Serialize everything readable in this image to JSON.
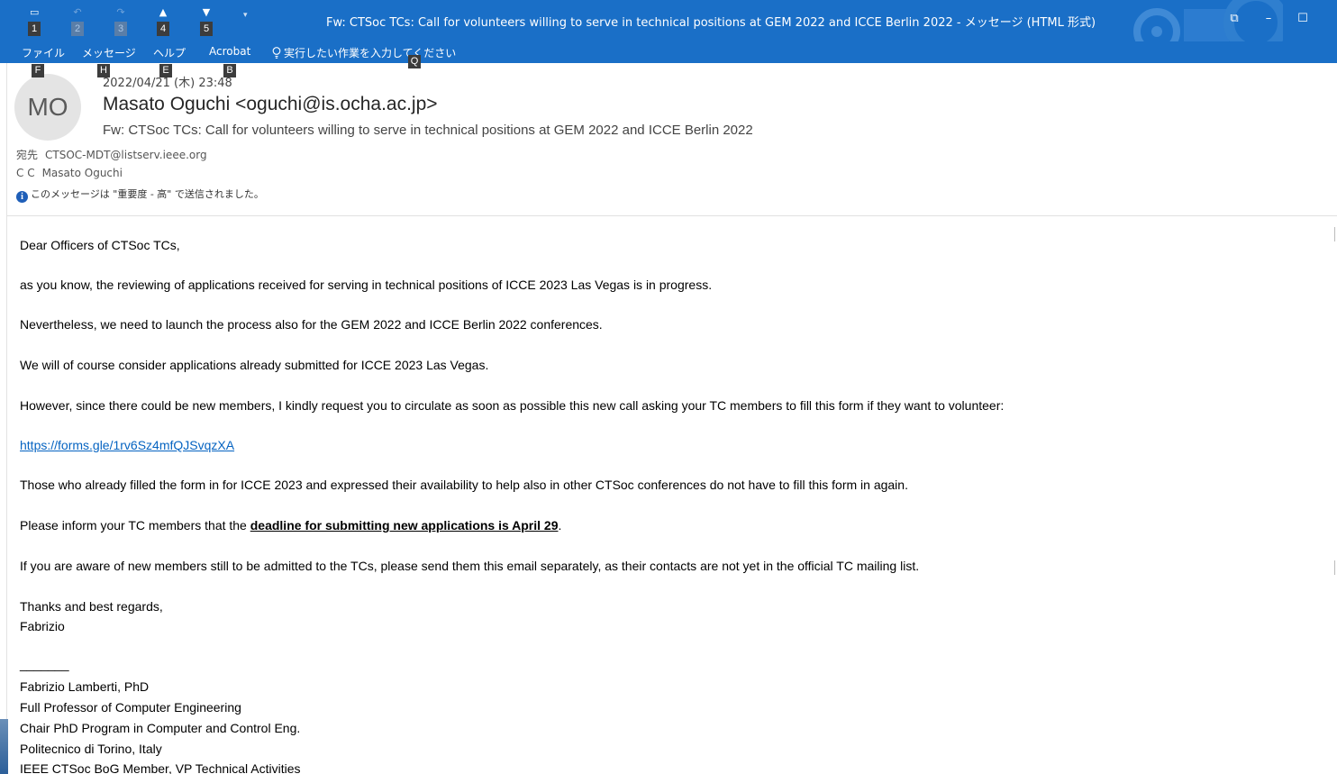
{
  "window": {
    "title": "Fw: CTSoc TCs: Call for volunteers willing to serve in technical positions at GEM 2022 and ICCE Berlin 2022  -  メッセージ (HTML 形式)",
    "minimize": "–",
    "maximize": "☐",
    "close": "✕",
    "ribbon_display": "⧉"
  },
  "quick_access": [
    {
      "name": "save",
      "key": "1"
    },
    {
      "name": "undo",
      "key": "2"
    },
    {
      "name": "redo",
      "key": "3"
    },
    {
      "name": "previous",
      "key": "4"
    },
    {
      "name": "next",
      "key": "5"
    }
  ],
  "ribbon": {
    "tabs": [
      "ファイル",
      "メッセージ",
      "ヘルプ",
      "Acrobat"
    ],
    "tell_me": "実行したい作業を入力してください",
    "keytips": {
      "file": "F",
      "message": "H",
      "help": "E",
      "acrobat": "B",
      "tell_me": "Q"
    }
  },
  "header": {
    "avatar_initials": "MO",
    "date": "2022/04/21 (木) 23:48",
    "sender": "Masato Oguchi <oguchi@is.ocha.ac.jp>",
    "subject": "Fw: CTSoc TCs: Call for volunteers willing to serve in technical positions at GEM 2022 and ICCE Berlin 2022",
    "to_label": "宛先",
    "to": "CTSOC-MDT@listserv.ieee.org",
    "cc_label": "C C",
    "cc": "Masato Oguchi",
    "importance_notice": "このメッセージは \"重要度 - 高\" で送信されました。"
  },
  "body": {
    "greeting": "Dear Officers of CTSoc TCs,",
    "p1": "as you know, the reviewing of applications received for serving in technical positions of ICCE 2023 Las Vegas is in progress.",
    "p2": "Nevertheless, we need to launch the process also for the GEM 2022 and ICCE Berlin 2022 conferences.",
    "p3": "We will of course consider applications already submitted for ICCE 2023 Las Vegas.",
    "p4": "However, since there could be new members, I kindly request you to circulate as soon as possible this new call asking your TC members to fill this form if they want to volunteer:",
    "link": "https://forms.gle/1rv6Sz4mfQJSvqzXA",
    "p5": "Those who already filled the form in for ICCE 2023 and expressed their availability to help also in other CTSoc conferences do not have to fill this form in again.",
    "p6_prefix": "Please inform your TC members that the ",
    "p6_deadline": "deadline for submitting new applications is April 29",
    "p6_suffix": ".",
    "p7": "If you are aware of new members still to be admitted to the TCs, please send them this email separately, as their contacts are not yet in the official TC mailing list.",
    "closing": "Thanks and best regards,",
    "signoff": "Fabrizio",
    "separator": "_______",
    "sig1": "Fabrizio Lamberti, PhD",
    "sig2": "Full Professor of Computer Engineering",
    "sig3": "Chair PhD Program in Computer and Control Eng.",
    "sig4": "Politecnico di Torino, Italy",
    "sig5": "IEEE CTSoc BoG Member, VP Technical Activities"
  },
  "colors": {
    "titlebar": "#1a6fc7",
    "link": "#0563c1",
    "info": "#1f5fb8"
  }
}
